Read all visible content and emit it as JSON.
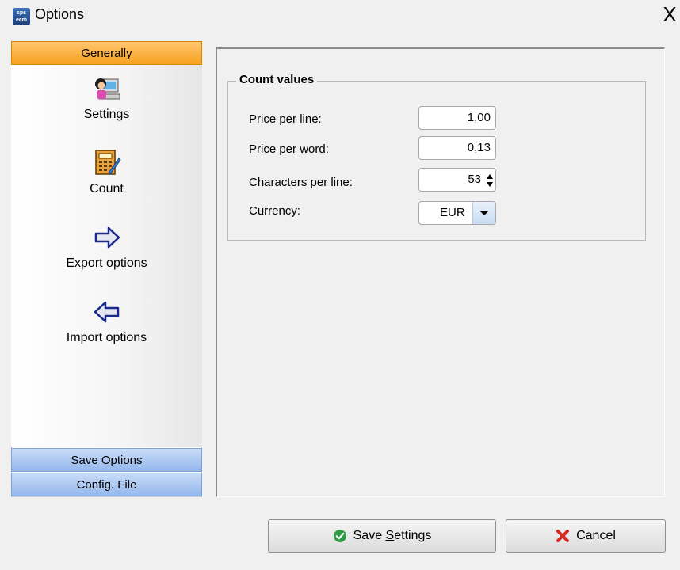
{
  "window": {
    "title": "Options",
    "app_icon_text": "sps ecm",
    "close_glyph": "X"
  },
  "sidebar": {
    "active_header": "Generally",
    "items": [
      {
        "label": "Settings",
        "icon": "person-computer-icon"
      },
      {
        "label": "Count",
        "icon": "calculator-icon"
      },
      {
        "label": "Export options",
        "icon": "arrow-right-icon"
      },
      {
        "label": "Import options",
        "icon": "arrow-left-icon"
      }
    ],
    "bottom_headers": [
      "Save Options",
      "Config. File"
    ]
  },
  "count_values": {
    "group_title": "Count values",
    "fields": [
      {
        "label": "Price per line:",
        "value": "1,00",
        "type": "text"
      },
      {
        "label": "Price per word:",
        "value": "0,13",
        "type": "text"
      },
      {
        "label": "Characters per line:",
        "value": "53",
        "type": "spinner"
      },
      {
        "label": "Currency:",
        "value": "EUR",
        "type": "select"
      }
    ]
  },
  "buttons": {
    "save_prefix": "Save ",
    "save_mnemonic": "S",
    "save_suffix": "ettings",
    "cancel": "Cancel"
  },
  "colors": {
    "active_header": "#f7a21e",
    "inactive_header": "#93b7ec"
  }
}
